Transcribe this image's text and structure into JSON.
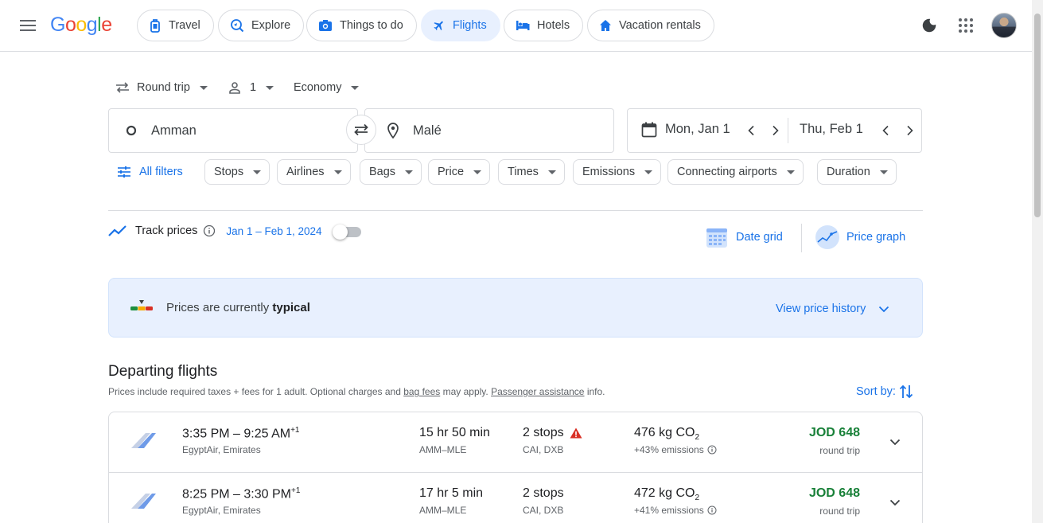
{
  "header": {
    "logo": [
      "G",
      "o",
      "o",
      "g",
      "l",
      "e"
    ],
    "nav": [
      {
        "label": "Travel",
        "icon": "travel-icon"
      },
      {
        "label": "Explore",
        "icon": "explore-icon"
      },
      {
        "label": "Things to do",
        "icon": "camera-icon"
      },
      {
        "label": "Flights",
        "icon": "flights-icon",
        "active": true
      },
      {
        "label": "Hotels",
        "icon": "bed-icon"
      },
      {
        "label": "Vacation rentals",
        "icon": "house-icon"
      }
    ]
  },
  "search": {
    "trip_type": "Round trip",
    "passengers": "1",
    "cabin": "Economy",
    "origin": "Amman",
    "destination": "Malé",
    "depart_date": "Mon, Jan 1",
    "return_date": "Thu, Feb 1"
  },
  "filters": {
    "all_filters": "All filters",
    "items": [
      "Stops",
      "Airlines",
      "Bags",
      "Price",
      "Times",
      "Emissions",
      "Connecting airports",
      "Duration"
    ]
  },
  "tracking": {
    "label": "Track prices",
    "range": "Jan 1 – Feb 1, 2024",
    "date_grid": "Date grid",
    "price_graph": "Price graph"
  },
  "insight": {
    "prefix": "Prices are currently ",
    "level": "typical",
    "history": "View price history"
  },
  "departing": {
    "title": "Departing flights",
    "sub_prefix": "Prices include required taxes + fees for 1 adult. Optional charges and ",
    "bag_fees": "bag fees",
    "sub_mid": " may apply. ",
    "assistance": "Passenger assistance",
    "sub_suffix": " info.",
    "sort": "Sort by:"
  },
  "flights": [
    {
      "depart": "3:35 PM",
      "arrive": "9:25 AM",
      "day_offset": "+1",
      "airline": "EgyptAir, Emirates",
      "duration": "15 hr 50 min",
      "route": "AMM–MLE",
      "stops": "2 stops",
      "warning": true,
      "airports": "CAI, DXB",
      "co2": "476 kg CO",
      "co2_sub": "2",
      "emissions": "+43% emissions",
      "price": "JOD 648",
      "price_type": "round trip"
    },
    {
      "depart": "8:25 PM",
      "arrive": "3:30 PM",
      "day_offset": "+1",
      "airline": "EgyptAir, Emirates",
      "duration": "17 hr 5 min",
      "route": "AMM–MLE",
      "stops": "2 stops",
      "warning": false,
      "airports": "CAI, DXB",
      "co2": "472 kg CO",
      "co2_sub": "2",
      "emissions": "+41% emissions",
      "price": "JOD 648",
      "price_type": "round trip"
    }
  ],
  "colors": {
    "accent": "#1a73e8",
    "price_green": "#188038",
    "warning_red": "#d93025"
  }
}
